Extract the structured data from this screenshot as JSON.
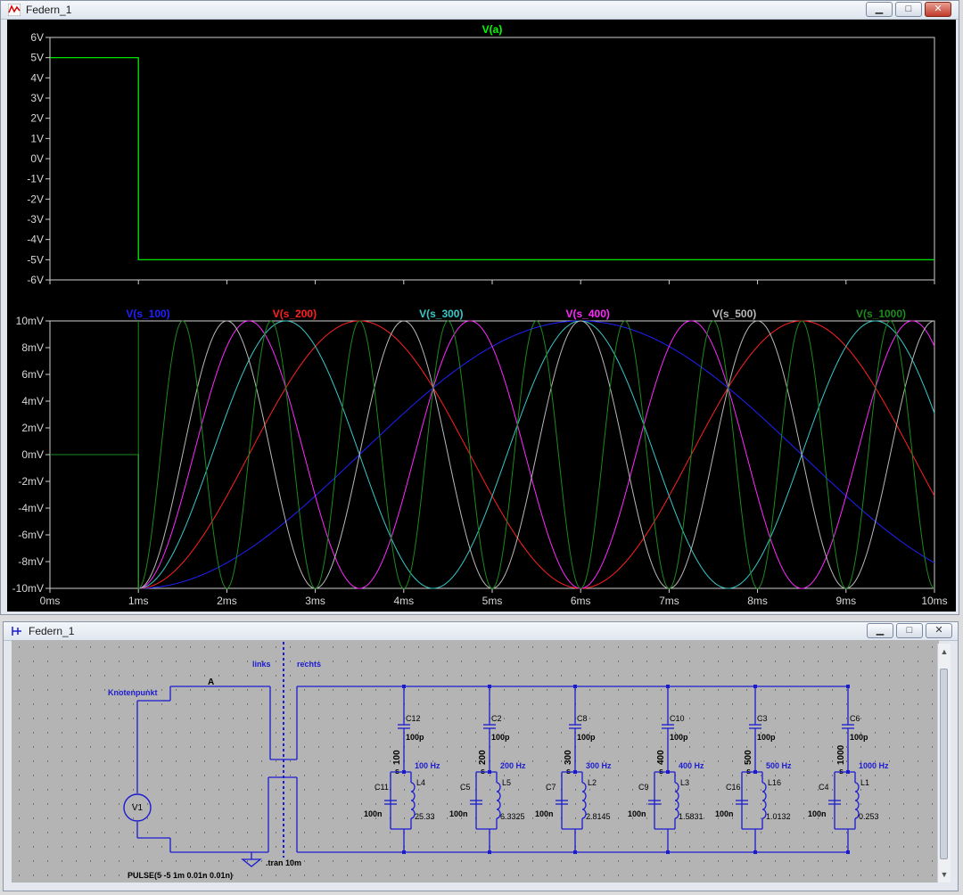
{
  "plot_window": {
    "title": "Federn_1",
    "buttons": {
      "minimize": "▁",
      "maximize": "□",
      "close": "✕"
    }
  },
  "schematic_window": {
    "title": "Federn_1",
    "buttons": {
      "minimize": "▁",
      "maximize": "□",
      "close": "✕"
    }
  },
  "colors": {
    "plot_bg": "#000000",
    "grid": "#cfcfcf",
    "tick_label": "#d8d8d8",
    "schematic_bg": "#b4b4b4",
    "wire": "#1b1bd0"
  },
  "chart_data": [
    {
      "type": "line",
      "title": "V(a)",
      "x_tick_labels": [],
      "y_tick_labels": [
        "6V",
        "5V",
        "4V",
        "3V",
        "2V",
        "1V",
        "0V",
        "-1V",
        "-2V",
        "-3V",
        "-4V",
        "-5V",
        "-6V"
      ],
      "xlim": [
        0,
        10
      ],
      "ylim": [
        -6,
        6
      ],
      "grid": false,
      "series": [
        {
          "name": "V(a)",
          "color": "#00ff00",
          "x": [
            0,
            1,
            1,
            10
          ],
          "y": [
            5,
            5,
            -5,
            -5
          ]
        }
      ]
    },
    {
      "type": "line",
      "title": "",
      "x_tick_labels": [
        "0ms",
        "1ms",
        "2ms",
        "3ms",
        "4ms",
        "5ms",
        "6ms",
        "7ms",
        "8ms",
        "9ms",
        "10ms"
      ],
      "y_tick_labels": [
        "10mV",
        "8mV",
        "6mV",
        "4mV",
        "2mV",
        "0mV",
        "-2mV",
        "-4mV",
        "-6mV",
        "-8mV",
        "-10mV"
      ],
      "xlim": [
        0,
        10
      ],
      "ylim": [
        -10,
        10
      ],
      "grid": false,
      "legend": "top",
      "series": [
        {
          "name": "V(s_100)",
          "color": "#2020ff",
          "frequency_hz": 100
        },
        {
          "name": "V(s_200)",
          "color": "#ff2020",
          "frequency_hz": 200
        },
        {
          "name": "V(s_300)",
          "color": "#38c8c8",
          "frequency_hz": 300
        },
        {
          "name": "V(s_400)",
          "color": "#ff28ff",
          "frequency_hz": 400
        },
        {
          "name": "V(s_500)",
          "color": "#b8b8b8",
          "frequency_hz": 500
        },
        {
          "name": "V(s_1000)",
          "color": "#1c8a1c",
          "frequency_hz": 1000
        }
      ]
    }
  ],
  "schematic": {
    "labels": {
      "knoten": "Knotenpunkt",
      "node_a": "A",
      "links": "links",
      "rechts": "rechts",
      "v1": "V1",
      "tran": ".tran 10m",
      "pulse": "PULSE(5 -5 1m 0.01n 0.01n)",
      "s_prefix": "s"
    },
    "branches": [
      {
        "c_top": "C12",
        "c_top_val": "100p",
        "s_num": "100",
        "freq": "100 Hz",
        "c_bot": "C11",
        "c_bot_val": "100n",
        "l": "L4",
        "l_val": "25.33"
      },
      {
        "c_top": "C2",
        "c_top_val": "100p",
        "s_num": "200",
        "freq": "200 Hz",
        "c_bot": "C5",
        "c_bot_val": "100n",
        "l": "L5",
        "l_val": "6.3325"
      },
      {
        "c_top": "C8",
        "c_top_val": "100p",
        "s_num": "300",
        "freq": "300 Hz",
        "c_bot": "C7",
        "c_bot_val": "100n",
        "l": "L2",
        "l_val": "2.8145"
      },
      {
        "c_top": "C10",
        "c_top_val": "100p",
        "s_num": "400",
        "freq": "400 Hz",
        "c_bot": "C9",
        "c_bot_val": "100n",
        "l": "L3",
        "l_val": "1.5831"
      },
      {
        "c_top": "C3",
        "c_top_val": "100p",
        "s_num": "500",
        "freq": "500 Hz",
        "c_bot": "C16",
        "c_bot_val": "100n",
        "l": "L16",
        "l_val": "1.0132"
      },
      {
        "c_top": "C6",
        "c_top_val": "100p",
        "s_num": "1000",
        "freq": "1000 Hz",
        "c_bot": "C4",
        "c_bot_val": "100n",
        "l": "L1",
        "l_val": "0.253"
      }
    ]
  }
}
